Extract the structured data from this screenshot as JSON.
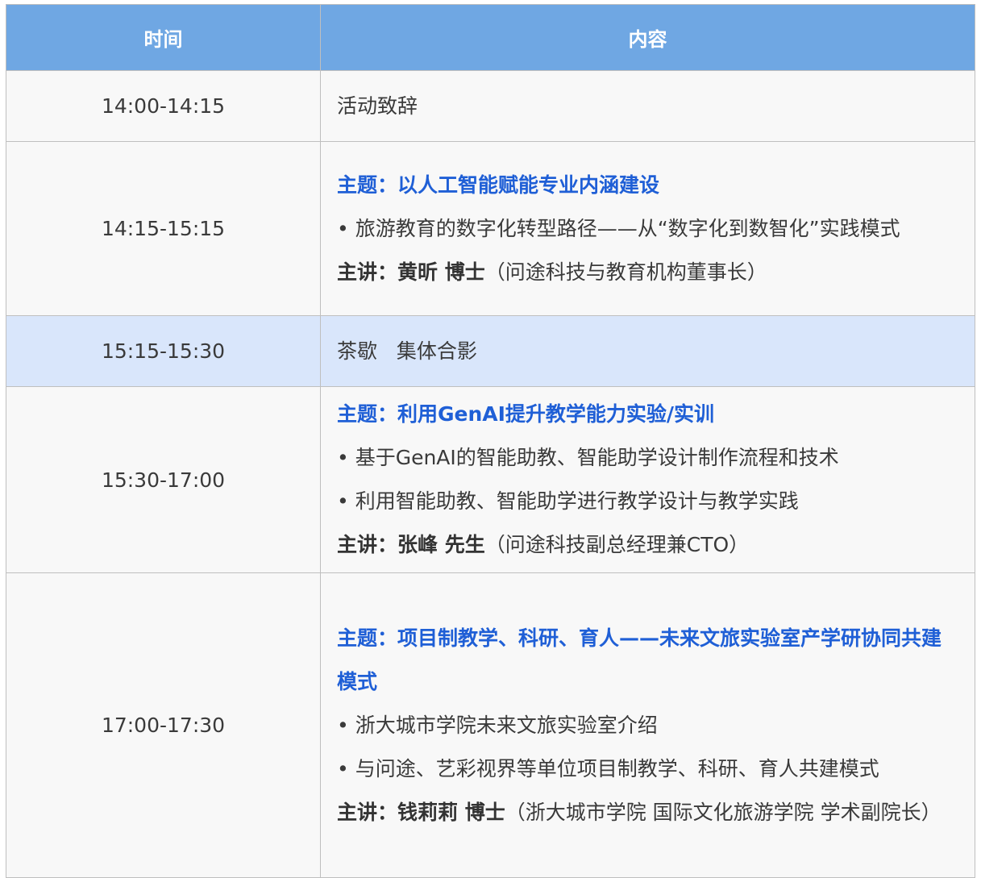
{
  "header": {
    "time": "时间",
    "content": "内容"
  },
  "rows": [
    {
      "time": "14:00-14:15",
      "text": "活动致辞"
    },
    {
      "time": "14:15-15:15",
      "topic": "主题：以人工智能赋能专业内涵建设",
      "bullets": [
        "• 旅游教育的数字化转型路径——从“数字化到数智化”实践模式"
      ],
      "speaker_label": "主讲：",
      "speaker_name": "黄昕 博士",
      "speaker_aff": "（问途科技与教育机构董事长）"
    },
    {
      "time": "15:15-15:30",
      "text": "茶歇   集体合影"
    },
    {
      "time": "15:30-17:00",
      "topic": "主题：利用GenAI提升教学能力实验/实训",
      "bullets": [
        "• 基于GenAI的智能助教、智能助学设计制作流程和技术",
        "• 利用智能助教、智能助学进行教学设计与教学实践"
      ],
      "speaker_label": "主讲：",
      "speaker_name": "张峰 先生",
      "speaker_aff": "（问途科技副总经理兼CTO）"
    },
    {
      "time": "17:00-17:30",
      "topic": "主题：项目制教学、科研、育人——未来文旅实验室产学研协同共建模式",
      "bullets": [
        "• 浙大城市学院未来文旅实验室介绍",
        "• 与问途、艺彩视界等单位项目制教学、科研、育人共建模式"
      ],
      "speaker_label": "主讲：",
      "speaker_name": "钱莉莉 博士",
      "speaker_aff": "（浙大城市学院 国际文化旅游学院 学术副院长）"
    }
  ],
  "colors": {
    "header_bg": "#6fa7e3",
    "topic": "#1f5fd6",
    "highlight_row": "#d9e6fb",
    "cell_bg": "#f8f8f8"
  }
}
